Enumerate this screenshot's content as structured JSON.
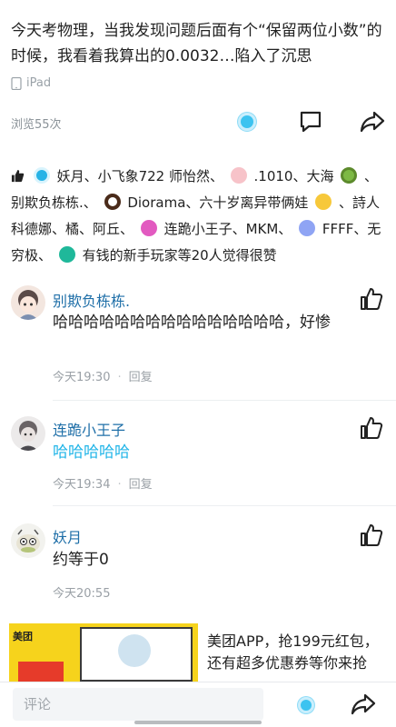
{
  "post": {
    "text": "今天考物理，当我发现问题后面有个“保留两位小数”的时候，我看着我算出的0.0032…陷入了沉思",
    "device": "iPad",
    "views": "浏览55次"
  },
  "likes": {
    "n1": "妖月、小飞象722 师怡然、",
    "n2": ".1010、大海",
    "n3": "、别欺负栋栋.、",
    "n4": "Diorama、六十岁离异带俩娃",
    "n5": "、詩人科德娜、橘、阿丘、",
    "n6": "连跪小王子、MKM、",
    "n7": "FFFF、无穷极、",
    "n8": "有钱的新手玩家等20人觉得很赞"
  },
  "comments": [
    {
      "name": "别欺负栋栋.",
      "text": "哈哈哈哈哈哈哈哈哈哈哈哈哈哈哈，好惨",
      "time": "今天19:30",
      "reply": "回复"
    },
    {
      "name": "连跪小王子",
      "text": "哈哈哈哈哈",
      "time": "今天19:34",
      "reply": "回复"
    },
    {
      "name": "妖月",
      "text": "约等于0",
      "time": "今天20:55"
    }
  ],
  "ad": {
    "brand": "美团",
    "text": "美团APP，抢199元红包，还有超多优惠券等你来抢"
  },
  "bottom": {
    "comment_placeholder": "评论"
  },
  "colors": {
    "accent": "#21b5e8",
    "name_blue": "#1f6fa8",
    "background": "#eef4f8"
  }
}
